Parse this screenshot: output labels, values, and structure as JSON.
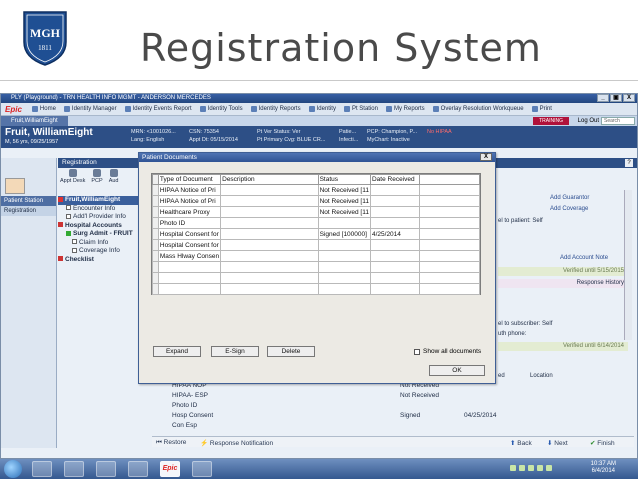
{
  "slide": {
    "title": "Registration System",
    "logo_text": "MGH",
    "logo_year": "1811"
  },
  "window": {
    "title": "PLY (Playground) - TRN HEALTH INFO MGMT - ANDERSON MERCEDES",
    "buttons": [
      "_",
      "▣",
      "X"
    ]
  },
  "menubar": {
    "logo": "Epic",
    "items": [
      "Home",
      "Identity Manager",
      "Identity Events Report",
      "Identity Tools",
      "Identity Reports",
      "Identity",
      "Pt Station",
      "My Reports",
      "Overlay Resolution Workqueue"
    ],
    "right_items": [
      "Print",
      "Log Out"
    ]
  },
  "tabbar": {
    "patient_tab": "Fruit,WilliamEight",
    "training": "TRAINING",
    "logout": "Log Out",
    "search_placeholder": "Search"
  },
  "patient": {
    "name": "Fruit, WilliamEight",
    "demo": "M, 56 yrs, 09/25/1957",
    "mrn": "MRN: <1001026...",
    "csn": "CSN: 75354",
    "lang": "Lang: English",
    "appt": "Appt Dt: 05/15/2014",
    "pt_ver": "Pt Ver Status: Ver",
    "pt_primary": "Pt Primary Cvg: BLUE CR...",
    "patie": "Patie...",
    "infecti": "Infecti...",
    "pcp": "PCP: Champion, P...",
    "mychart": "MyChart: Inactive",
    "hipaa": "No HIPAA"
  },
  "leftnav": {
    "items": [
      {
        "label": "Patient Station"
      },
      {
        "label": "Registration"
      }
    ]
  },
  "activity": {
    "title": "Registration",
    "help": "?",
    "toolbar": [
      "Appt Desk",
      "PCP",
      "Aud"
    ]
  },
  "tree": {
    "items": [
      {
        "label": "Fruit,WilliamEight",
        "level": 0,
        "selected": true
      },
      {
        "label": "Encounter Info",
        "level": 1
      },
      {
        "label": "Add'l Provider Info",
        "level": 1
      },
      {
        "label": "Hospital Accounts",
        "level": 0
      },
      {
        "label": "Surg Admit - FRUIT",
        "level": 1
      },
      {
        "label": "Claim Info",
        "level": 2
      },
      {
        "label": "Coverage Info",
        "level": 2
      },
      {
        "label": "Checklist",
        "level": 0
      }
    ]
  },
  "rightpanel": {
    "add_guarantor": "Add Guarantor",
    "add_coverage": "Add Coverage",
    "rel_patient": "el to patient: Self",
    "add_account_note": "Add Account Note",
    "verified1": "Verified until 5/15/2015",
    "response_history": "Response History",
    "rel_subscriber": "el to subscriber: Self",
    "auth_phone": "uth phone:",
    "verified2": "Verified until 6/14/2014",
    "ed": "ed",
    "location": "Location"
  },
  "dialog": {
    "title": "Patient Documents",
    "close": "X",
    "columns": [
      "Type of Document",
      "Description",
      "Status",
      "Date Received"
    ],
    "rows": [
      [
        "HIPAA Notice of Pri",
        "",
        "Not Received [11",
        ""
      ],
      [
        "HIPAA Notice of Pri",
        "",
        "Not Received [11",
        ""
      ],
      [
        "Healthcare Proxy",
        "",
        "Not Received [11",
        ""
      ],
      [
        "Photo ID",
        "",
        "",
        ""
      ],
      [
        "Hospital Consent for",
        "",
        "Signed [100000]",
        "4/25/2014"
      ],
      [
        "Hospital Consent for",
        "",
        "",
        ""
      ],
      [
        "Mass Hlway Consen",
        "",
        "",
        ""
      ],
      [
        "",
        "",
        "",
        ""
      ],
      [
        "",
        "",
        "",
        ""
      ],
      [
        "",
        "",
        "",
        ""
      ]
    ],
    "expand": "Expand",
    "esign": "E-Sign",
    "delete": "Delete",
    "show_all": "Show all documents",
    "ok": "OK"
  },
  "background": {
    "rows": [
      {
        "label": "HIPAA NOP",
        "status": "Not Received",
        "date": ""
      },
      {
        "label": "HIPAA- ESP",
        "status": "Not Received",
        "date": ""
      },
      {
        "label": "Photo ID",
        "status": "",
        "date": ""
      },
      {
        "label": "Hosp Consent",
        "status": "Signed",
        "date": "04/25/2014"
      },
      {
        "label": "Con Esp",
        "status": "",
        "date": ""
      }
    ]
  },
  "bottombar": {
    "restore": "Restore",
    "response_notification": "Response Notification",
    "back": "Back",
    "next": "Next",
    "finish": "Finish"
  },
  "taskbar": {
    "time": "10:37 AM",
    "date": "6/4/2014",
    "epic_label": "Epic"
  }
}
